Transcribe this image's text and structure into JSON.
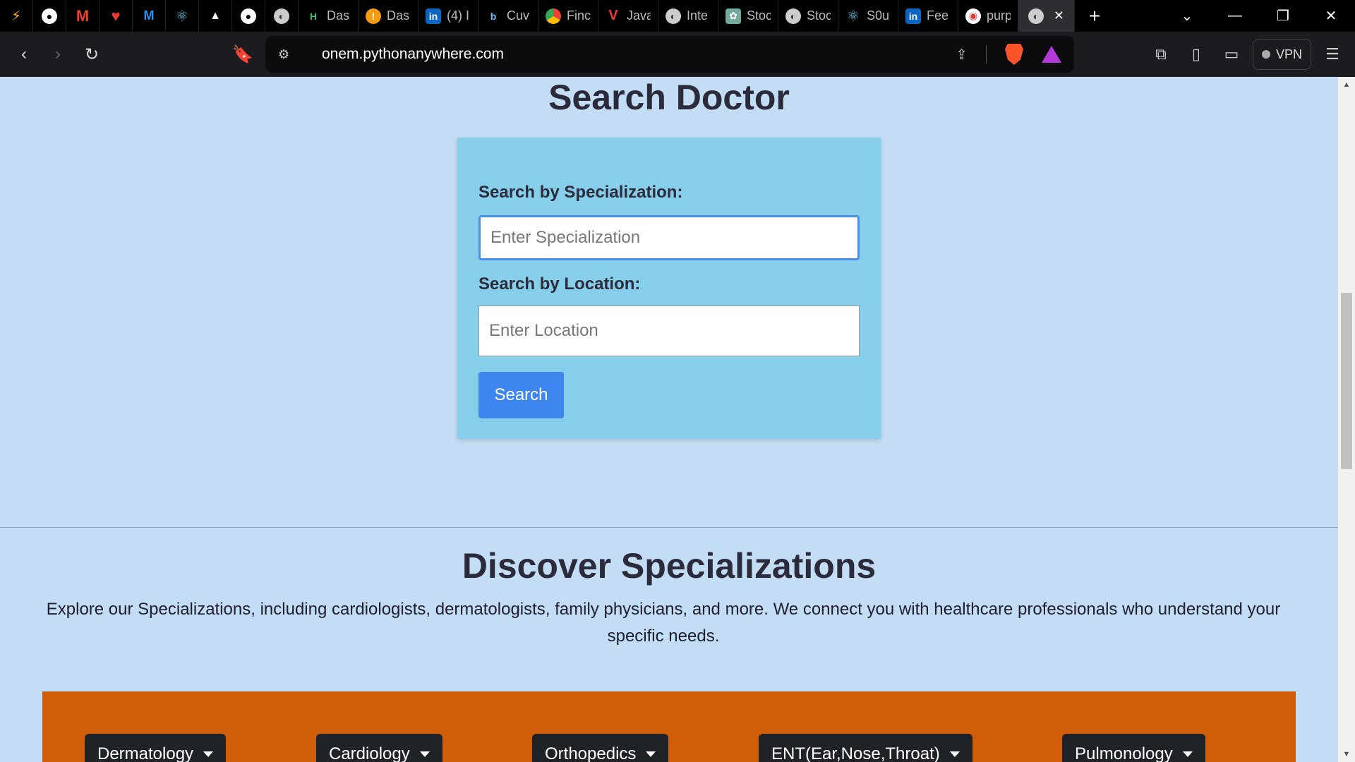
{
  "browser": {
    "tabs": [
      {
        "icon": "devto-icon",
        "label": ""
      },
      {
        "icon": "github-icon",
        "label": ""
      },
      {
        "icon": "gmail-icon",
        "label": ""
      },
      {
        "icon": "heart-icon",
        "label": ""
      },
      {
        "icon": "material-ui-icon",
        "label": ""
      },
      {
        "icon": "react-icon",
        "label": ""
      },
      {
        "icon": "vercel-icon",
        "label": ""
      },
      {
        "icon": "github-icon",
        "label": ""
      },
      {
        "icon": "globe-icon",
        "label": ""
      },
      {
        "icon": "hackerrank-icon",
        "label": "Das"
      },
      {
        "icon": "info-icon",
        "label": "Das"
      },
      {
        "icon": "linkedin-icon",
        "label": "(4) I"
      },
      {
        "icon": "bootstrap-icon",
        "label": "Cuv"
      },
      {
        "icon": "chrome-icon",
        "label": "Finc"
      },
      {
        "icon": "vivaldi-icon",
        "label": "Java"
      },
      {
        "icon": "globe-icon",
        "label": "Inte"
      },
      {
        "icon": "chatgpt-icon",
        "label": "Stoc"
      },
      {
        "icon": "globe-icon",
        "label": "Stoc"
      },
      {
        "icon": "react-icon",
        "label": "S0u"
      },
      {
        "icon": "linkedin-icon",
        "label": "Fee"
      },
      {
        "icon": "brave-shield-icon",
        "label": "purp"
      }
    ],
    "active_tab_close": "✕",
    "new_tab": "+",
    "url": "onem.pythonanywhere.com",
    "vpn_label": "VPN"
  },
  "page": {
    "title": "Search Doctor",
    "form": {
      "specialization_label": "Search by Specialization:",
      "specialization_placeholder": "Enter Specialization",
      "location_label": "Search by Location:",
      "location_placeholder": "Enter Location",
      "search_button": "Search"
    },
    "discover": {
      "title": "Discover Specializations",
      "description": "Explore our Specializations, including cardiologists, dermatologists, family physicians, and more. We connect you with healthcare professionals who understand your specific needs."
    },
    "specializations": [
      "Dermatology",
      "Cardiology",
      "Orthopedics",
      "ENT(Ear,Nose,Throat)",
      "Pulmonology"
    ]
  },
  "colors": {
    "page_bg": "#c3ddf4",
    "card_bg": "#87ceeb",
    "button_blue": "#3d86f0",
    "band_orange": "#d05d0a",
    "dropdown_dark": "#1f2328"
  }
}
